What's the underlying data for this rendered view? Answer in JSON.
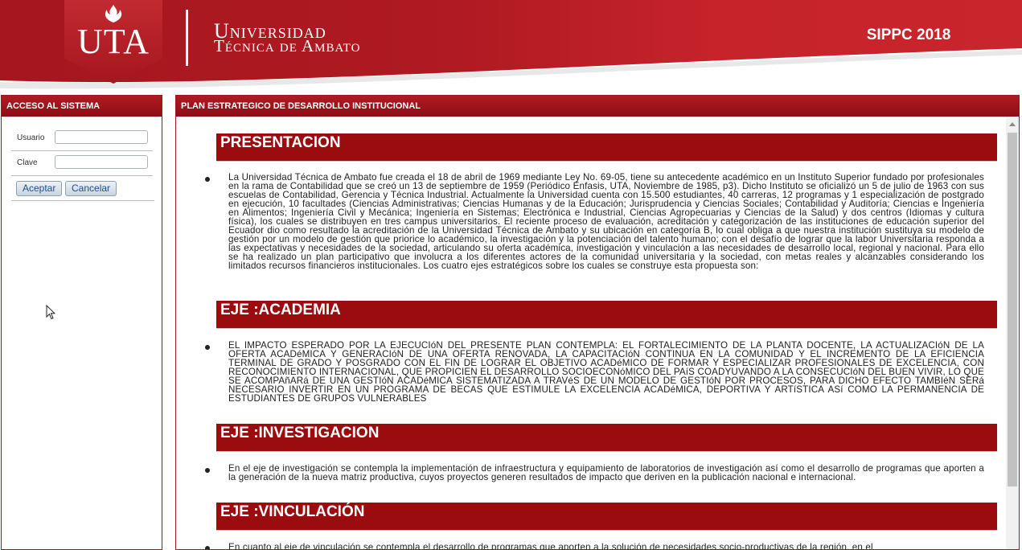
{
  "header": {
    "logo_text": "UTA",
    "university_line1": "Universidad",
    "university_line2": "Técnica de Ambato",
    "system_name": "SIPPC 2018"
  },
  "login": {
    "title": "ACCESO AL SISTEMA",
    "user_label": "Usuario",
    "user_value": "",
    "password_label": "Clave",
    "password_value": "",
    "accept_label": "Aceptar",
    "cancel_label": "Cancelar"
  },
  "main": {
    "title": "PLAN ESTRATEGICO DE DESARROLLO INSTITUCIONAL",
    "sections": [
      {
        "heading": "PRESENTACION",
        "text": "La Universidad Técnica de Ambato fue creada el 18 de abril de 1969 mediante Ley No. 69-05, tiene su antecedente académico en un Instituto Superior fundado por profesionales en la rama de Contabilidad que se creó un 13 de septiembre de 1959 (Periódico Enfasis, UTA, Noviembre de 1985, p3). Dicho Instituto se oficializó un 5 de julio de 1963 con sus escuelas de Contabilidad, Gerencia y Técnica Industrial. Actualmente la Universidad cuenta con 15.500 estudiantes, 40 carreras, 12 programas y 1 especialización de postgrado en ejecución, 10 facultades (Ciencias Administrativas; Ciencias Humanas y de la Educación; Jurisprudencia y Ciencias Sociales; Contabilidad y Auditoría; Ciencias e Ingeniería en Alimentos; Ingeniería Civil y Mecánica; Ingeniería en Sistemas; Electrónica e Industrial, Ciencias Agropecuarias y Ciencias de la Salud) y dos centros (Idiomas y cultura física), los cuales se distribuyen en tres campus universitarios. El reciente proceso de evaluación, acreditación y categorización de las instituciones de educación superior del Ecuador dio como resultado la acreditación de la Universidad Técnica de Ambato y su ubicación en categoría B, lo cual obliga a que nuestra institución sustituya su modelo de gestión por un modelo de gestión que priorice lo académico, la investigación y la potenciación del talento humano; con el desafío de lograr que la labor Universitaria responda a las expectativas y necesidades de la sociedad, articulando su oferta académica, investigación y vinculación a las necesidades de desarrollo local, regional y nacional. Para ello se ha realizado un plan participativo que involucra a los diferentes actores de la comunidad universitaria y la sociedad, con metas reales y alcanzables considerando los limitados recursos financieros institucionales. Los cuatro ejes estratégicos sobre los cuales se construye esta propuesta son:"
      },
      {
        "heading": "EJE   :ACADEMIA",
        "text": "EL IMPACTO ESPERADO POR LA EJECUCIóN DEL PRESENTE PLAN CONTEMPLA: EL FORTALECIMIENTO DE LA PLANTA DOCENTE, LA ACTUALIZACIóN DE LA OFERTA ACADéMICA Y GENERACIóN DE UNA OFERTA RENOVADA, LA CAPACITACIóN CONTINUA EN LA COMUNIDAD Y EL INCREMENTO DE LA EFICIENCIA TERMINAL DE GRADO Y POSGRADO CON EL FIN DE LOGRAR EL OBJETIVO ACADéMICO DE FORMAR Y ESPECIALIZAR PROFESIONALES DE EXCELENCIA, CON RECONOCIMIENTO INTERNACIONAL, QUE PROPICIEN EL DESARROLLO SOCIOECONóMICO DEL PAíS COADYUVANDO A LA CONSECUCIóN DEL BUEN VIVIR, LO QUE SE ACOMPAñARá DE UNA GESTIóN ACADéMICA SISTEMATIZADA A TRAVéS DE UN MODELO DE GESTIóN POR PROCESOS, PARA DICHO EFECTO TAMBIéN SERá NECESARIO INVERTIR EN UN PROGRAMA DE BECAS QUE ESTIMULE LA EXCELENCIA ACADéMICA, DEPORTIVA Y ARTíSTICA ASí COMO LA PERMANENCIA DE ESTUDIANTES DE GRUPOS VULNERABLES"
      },
      {
        "heading": "EJE   :INVESTIGACION",
        "text": "En el eje de investigación se contempla la implementación de infraestructura y equipamiento de laboratorios de investigación así como el desarrollo de programas que aporten a la generación de la nueva matriz productiva, cuyos proyectos generen resultados de impacto que deriven en la publicación nacional e internacional."
      },
      {
        "heading": "EJE   :VINCULACIÓN",
        "text": "En cuanto al eje de vinculación se contempla el desarrollo de programas que aporten a la solución de necesidades socio-productivas de la región, en el"
      }
    ]
  },
  "icons": {
    "flame": "flame-icon",
    "cursor": "mouse-pointer-icon",
    "scroll_up": "scroll-up-arrow-icon"
  },
  "colors": {
    "brand_red": "#9b0c0f",
    "header_red": "#b01a22",
    "button_text": "#1f4f8a"
  }
}
